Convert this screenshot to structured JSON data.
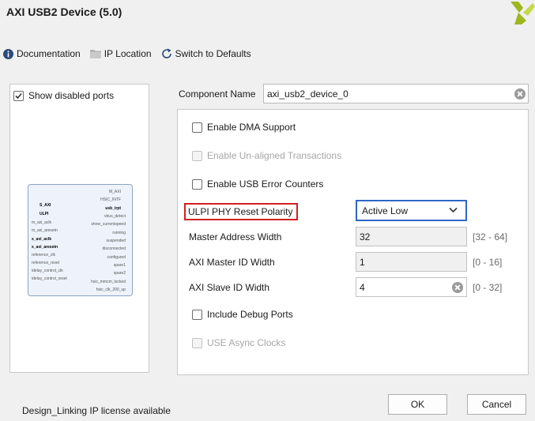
{
  "window": {
    "title": "AXI USB2 Device (5.0)"
  },
  "toolbar": {
    "documentation": "Documentation",
    "ip_location": "IP Location",
    "switch_defaults": "Switch to Defaults"
  },
  "left_panel": {
    "show_disabled_ports": {
      "label": "Show disabled ports",
      "checked": true
    },
    "ip_symbol": {
      "pins_right": [
        "M_AXI",
        "HSIC_INTF",
        "usb_irpt",
        "vbus_detect",
        "show_currentspeed",
        "running",
        "suspended",
        "disconnected",
        "configured",
        "spare1",
        "spare2",
        "hsic_mmcm_locked",
        "hsic_clk_200_up"
      ],
      "pins_left": [
        "S_AXI",
        "ULPI",
        "m_axi_aclk",
        "m_axi_aresetn",
        "s_axi_aclk",
        "s_axi_aresetn",
        "reference_clk",
        "reference_reset",
        "idelay_control_clk",
        "idelay_control_reset"
      ]
    }
  },
  "component_name": {
    "label": "Component Name",
    "value": "axi_usb2_device_0"
  },
  "options": {
    "enable_dma": {
      "label": "Enable DMA Support",
      "checked": false,
      "disabled": false
    },
    "unaligned": {
      "label": "Enable Un-aligned Transactions",
      "checked": false,
      "disabled": true
    },
    "usb_error": {
      "label": "Enable USB Error Counters",
      "checked": false,
      "disabled": false
    },
    "ulpi_reset": {
      "label": "ULPI PHY Reset Polarity",
      "value": "Active Low"
    },
    "master_addr": {
      "label": "Master Address Width",
      "value": "32",
      "range": "[32 - 64]"
    },
    "master_id": {
      "label": "AXI Master ID Width",
      "value": "1",
      "range": "[0 - 16]"
    },
    "slave_id": {
      "label": "AXI Slave ID Width",
      "value": "4",
      "range": "[0 - 32]"
    },
    "debug_ports": {
      "label": "Include Debug Ports",
      "checked": false,
      "disabled": false
    },
    "async_clocks": {
      "label": "USE Async Clocks",
      "checked": false,
      "disabled": true
    }
  },
  "footer": {
    "status": "Design_Linking IP license available",
    "ok": "OK",
    "cancel": "Cancel"
  },
  "colors": {
    "accent": "#2e66c7",
    "highlight": "#d21f1f",
    "logo": "#9db71e"
  },
  "icons": [
    "info-icon",
    "folder-icon",
    "refresh-icon",
    "xilinx-logo",
    "clear-icon",
    "chevron-down-icon",
    "checkmark-icon"
  ]
}
